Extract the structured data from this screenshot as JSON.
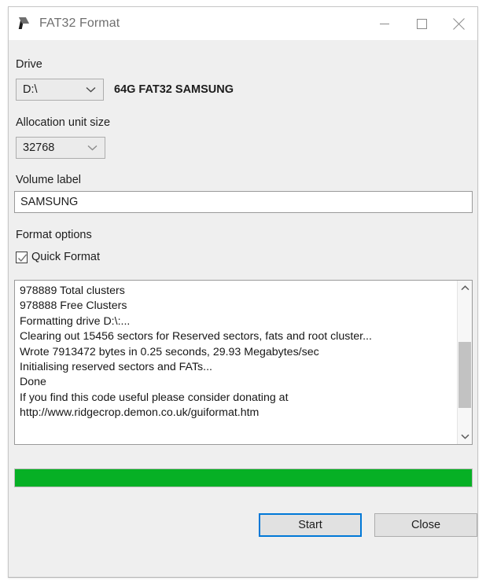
{
  "window": {
    "title": "FAT32 Format",
    "icon": "app-flag-icon",
    "controls": {
      "minimize": "minimize-icon",
      "maximize": "maximize-icon",
      "close": "close-icon"
    }
  },
  "drive": {
    "label": "Drive",
    "selected": "D:\\",
    "info": "64G FAT32 SAMSUNG"
  },
  "allocation": {
    "label": "Allocation unit size",
    "selected": "32768"
  },
  "volume": {
    "label": "Volume label",
    "value": "SAMSUNG",
    "placeholder": ""
  },
  "format_options": {
    "label": "Format options",
    "quick_format_label": "Quick Format",
    "quick_format_checked": true
  },
  "log": {
    "lines": [
      "978889 Total clusters",
      "978888 Free Clusters",
      "Formatting drive D:\\:...",
      "Clearing out 15456 sectors for Reserved sectors, fats and root cluster...",
      "Wrote 7913472 bytes in 0.25 seconds, 29.93 Megabytes/sec",
      "Initialising reserved sectors and FATs...",
      "Done",
      "If you find this code useful please consider donating at",
      "http://www.ridgecrop.demon.co.uk/guiformat.htm"
    ],
    "text": "978889 Total clusters\n978888 Free Clusters\nFormatting drive D:\\:...\nClearing out 15456 sectors for Reserved sectors, fats and root cluster...\nWrote 7913472 bytes in 0.25 seconds, 29.93 Megabytes/sec\nInitialising reserved sectors and FATs...\nDone\nIf you find this code useful please consider donating at\nhttp://www.ridgecrop.demon.co.uk/guiformat.htm",
    "scroll_up_icon": "chevron-up-icon",
    "scroll_down_icon": "chevron-down-icon"
  },
  "progress": {
    "percent": 100,
    "color": "#06b025"
  },
  "buttons": {
    "start": "Start",
    "close": "Close"
  },
  "colors": {
    "accent": "#0078d7",
    "progress_green": "#06b025",
    "dialog_background": "#efefef",
    "titlebar_background": "#ffffff"
  }
}
